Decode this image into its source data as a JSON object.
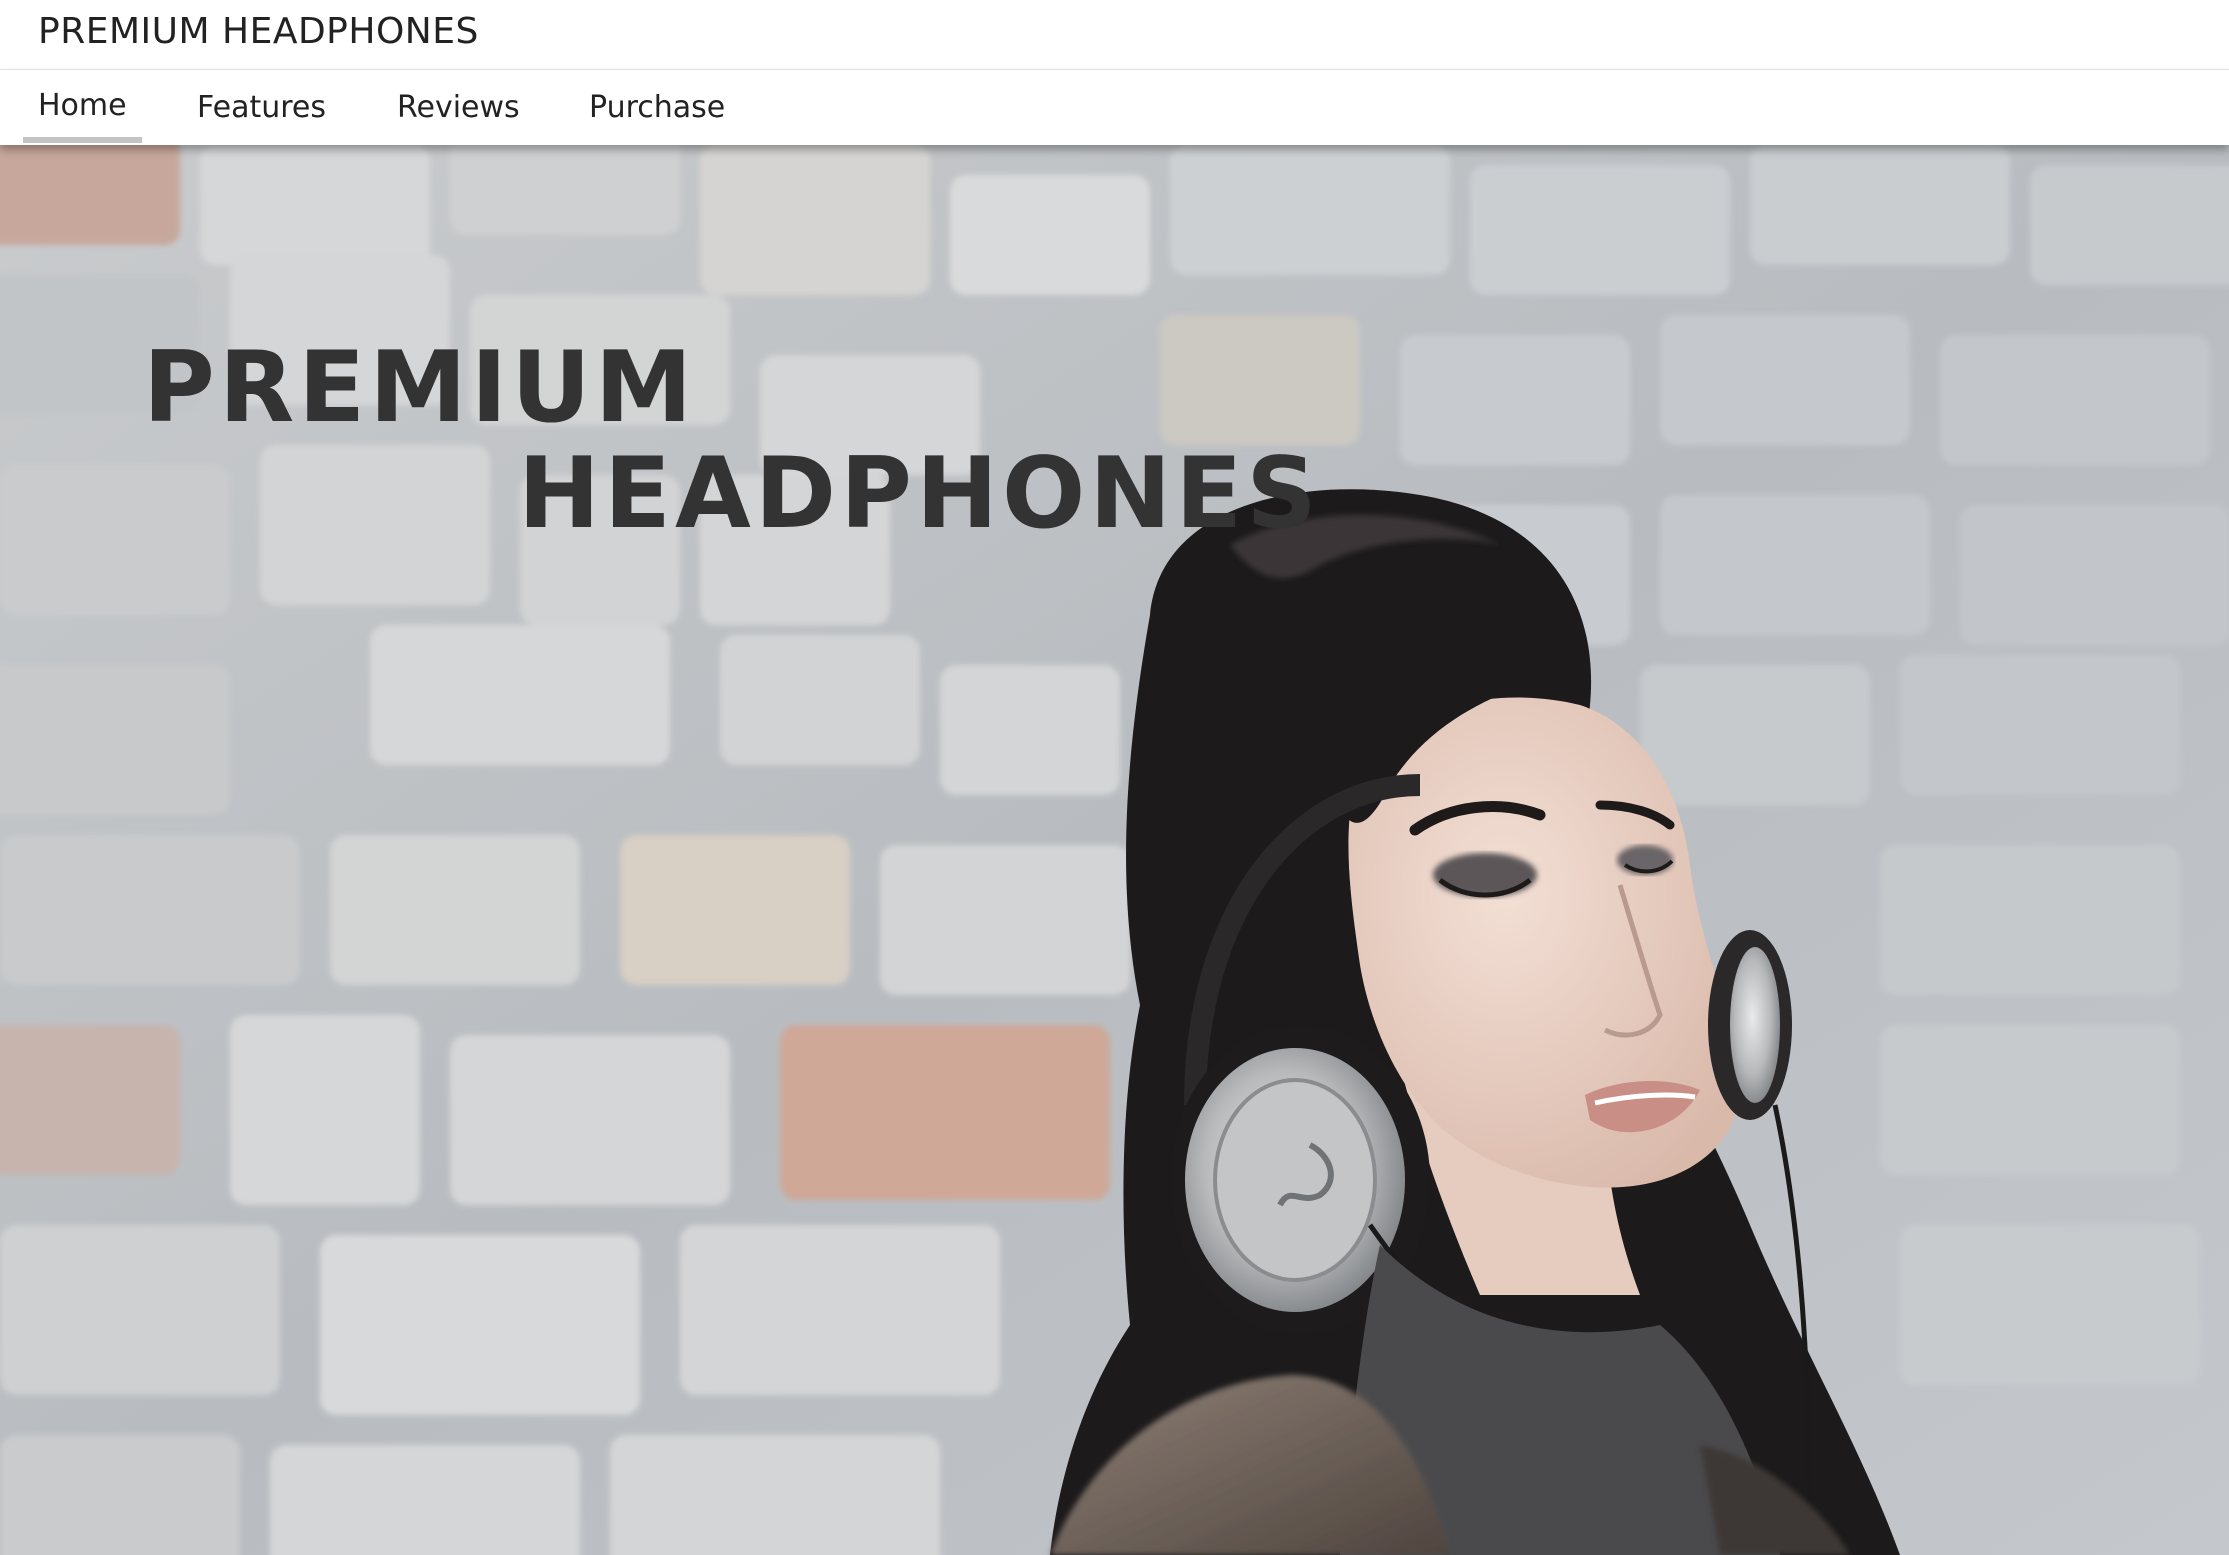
{
  "header": {
    "brand": "PREMIUM HEADPHONES"
  },
  "nav": {
    "items": [
      {
        "label": "Home",
        "active": true
      },
      {
        "label": "Features",
        "active": false
      },
      {
        "label": "Reviews",
        "active": false
      },
      {
        "label": "Purchase",
        "active": false
      }
    ]
  },
  "hero": {
    "title_line1": "PREMIUM",
    "title_line2": "HEADPHONES",
    "image_icon": "woman-with-headphones-photo"
  },
  "colors": {
    "title": "#333333",
    "nav_active_underline": "#c4c4c4",
    "wall": "#c3c6c9"
  }
}
